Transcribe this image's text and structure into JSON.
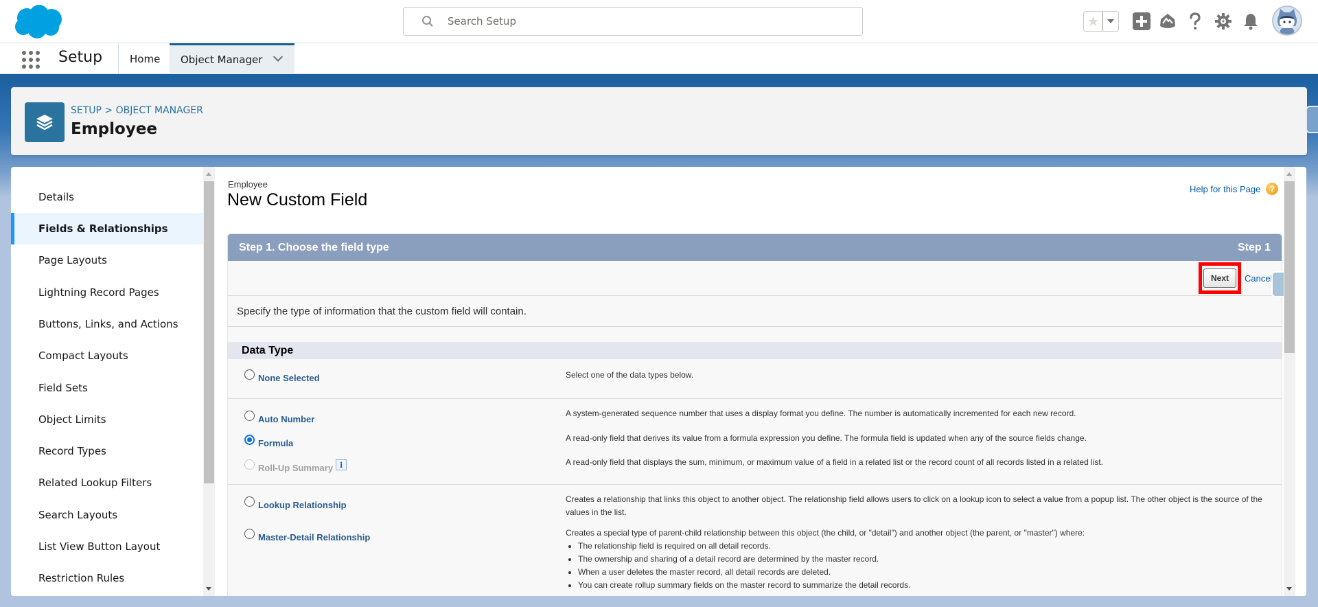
{
  "header": {
    "search_placeholder": "Search Setup",
    "icons": [
      "favorites-star-icon",
      "favorites-dropdown-icon",
      "global-add-icon",
      "trailhead-icon",
      "help-icon",
      "setup-gear-icon",
      "notifications-bell-icon",
      "user-avatar"
    ]
  },
  "nav": {
    "app_name": "Setup",
    "tabs": [
      {
        "label": "Home",
        "active": false
      },
      {
        "label": "Object Manager",
        "active": true
      }
    ]
  },
  "object_header": {
    "breadcrumb": "SETUP > OBJECT MANAGER",
    "title": "Employee"
  },
  "sidebar": {
    "items": [
      {
        "label": "Details",
        "active": false
      },
      {
        "label": "Fields & Relationships",
        "active": true
      },
      {
        "label": "Page Layouts",
        "active": false
      },
      {
        "label": "Lightning Record Pages",
        "active": false
      },
      {
        "label": "Buttons, Links, and Actions",
        "active": false
      },
      {
        "label": "Compact Layouts",
        "active": false
      },
      {
        "label": "Field Sets",
        "active": false
      },
      {
        "label": "Object Limits",
        "active": false
      },
      {
        "label": "Record Types",
        "active": false
      },
      {
        "label": "Related Lookup Filters",
        "active": false
      },
      {
        "label": "Search Layouts",
        "active": false
      },
      {
        "label": "List View Button Layout",
        "active": false
      },
      {
        "label": "Restriction Rules",
        "active": false
      }
    ]
  },
  "page": {
    "subtitle": "Employee",
    "title": "New Custom Field",
    "help_link": "Help for this Page",
    "step_title": "Step 1. Choose the field type",
    "step_indicator": "Step 1",
    "next_label": "Next",
    "cancel_label": "Cancel",
    "intro": "Specify the type of information that the custom field will contain.",
    "section_title": "Data Type",
    "options": [
      {
        "label": "None Selected",
        "checked": false,
        "disabled": false,
        "description": "Select one of the data types below."
      },
      {
        "label": "Auto Number",
        "checked": false,
        "disabled": false,
        "description": "A system-generated sequence number that uses a display format you define. The number is automatically incremented for each new record."
      },
      {
        "label": "Formula",
        "checked": true,
        "disabled": false,
        "description": "A read-only field that derives its value from a formula expression you define. The formula field is updated when any of the source fields change."
      },
      {
        "label": "Roll-Up Summary",
        "checked": false,
        "disabled": true,
        "description": "A read-only field that displays the sum, minimum, or maximum value of a field in a related list or the record count of all records listed in a related list."
      },
      {
        "label": "Lookup Relationship",
        "checked": false,
        "disabled": false,
        "description": "Creates a relationship that links this object to another object. The relationship field allows users to click on a lookup icon to select a value from a popup list. The other object is the source of the values in the list."
      },
      {
        "label": "Master-Detail Relationship",
        "checked": false,
        "disabled": false,
        "description": "Creates a special type of parent-child relationship between this object (the child, or \"detail\") and another object (the parent, or \"master\") where:",
        "bullets": [
          "The relationship field is required on all detail records.",
          "The ownership and sharing of a detail record are determined by the master record.",
          "When a user deletes the master record, all detail records are deleted.",
          "You can create rollup summary fields on the master record to summarize the detail records."
        ]
      }
    ],
    "info_icon_label": "i"
  },
  "colors": {
    "brand_blue": "#00a1e0",
    "object_icon": "#2a739e",
    "step_bar": "#8a9ebe",
    "active_nav_accent": "#1b5f8c",
    "sidebar_active_accent": "#1b96ff",
    "highlight_box": "#ff0000"
  }
}
